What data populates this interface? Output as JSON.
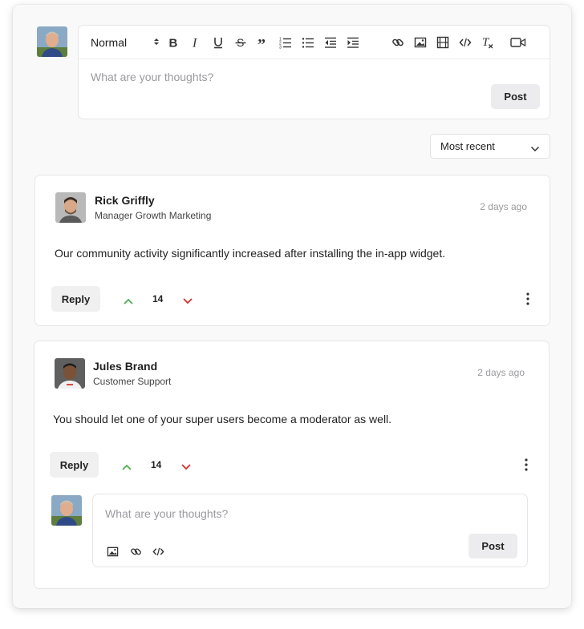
{
  "composer": {
    "format_value": "Normal",
    "placeholder": "What are your thoughts?",
    "post_label": "Post",
    "toolbar_icons": [
      "bold-icon",
      "italic-icon",
      "underline-icon",
      "strikethrough-icon",
      "quote-icon",
      "ordered-list-icon",
      "bullet-list-icon",
      "outdent-icon",
      "indent-icon",
      "link-icon",
      "image-icon",
      "video-icon",
      "code-icon",
      "clear-format-icon",
      "camera-icon"
    ]
  },
  "sort": {
    "value": "Most recent"
  },
  "comments": [
    {
      "author": "Rick Griffly",
      "role": "Manager Growth Marketing",
      "time": "2 days ago",
      "text": "Our community activity significantly increased after installing the in-app widget.",
      "reply_label": "Reply",
      "votes": "14"
    },
    {
      "author": "Jules Brand",
      "role": "Customer Support",
      "time": "2 days ago",
      "text": "You should let one of your super users become a moderator as well.",
      "reply_label": "Reply",
      "votes": "14",
      "reply_box": {
        "placeholder": "What are your thoughts?",
        "post_label": "Post"
      }
    }
  ],
  "colors": {
    "upvote": "#4caf50",
    "downvote": "#d32f2f",
    "button_bg": "#ececee",
    "border": "#e6e6e8"
  }
}
